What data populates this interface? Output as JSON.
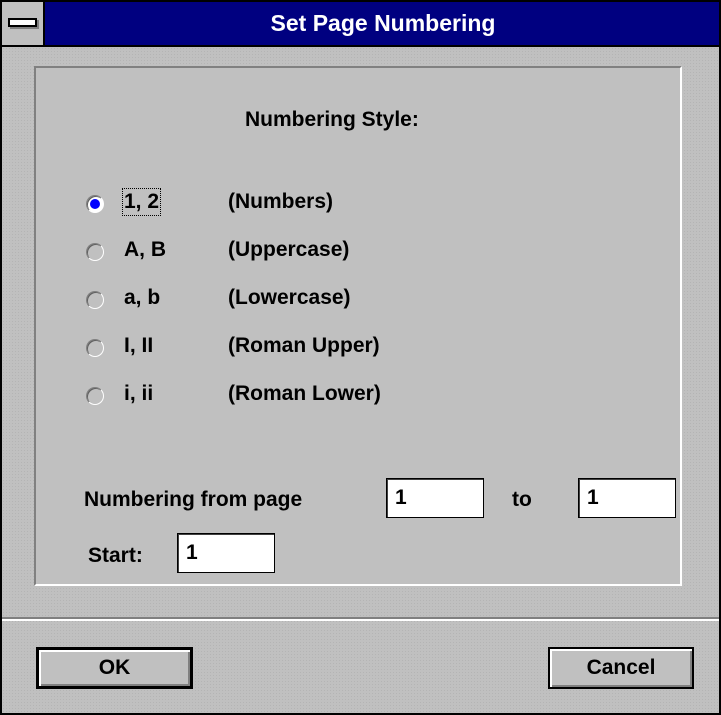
{
  "window": {
    "title": "Set Page Numbering"
  },
  "numbering_style": {
    "heading": "Numbering Style:",
    "options": [
      {
        "value": "1, 2",
        "description": "(Numbers)",
        "checked": true
      },
      {
        "value": "A, B",
        "description": "(Uppercase)",
        "checked": false
      },
      {
        "value": "a, b",
        "description": "(Lowercase)",
        "checked": false
      },
      {
        "value": "I, II",
        "description": "(Roman Upper)",
        "checked": false
      },
      {
        "value": "i, ii",
        "description": "(Roman Lower)",
        "checked": false
      }
    ]
  },
  "range": {
    "from_label": "Numbering from page",
    "from_value": "1",
    "to_label": "to",
    "to_value": "1",
    "start_label": "Start:",
    "start_value": "1"
  },
  "buttons": {
    "ok_label": "OK",
    "cancel_label": "Cancel"
  },
  "colors": {
    "titlebar": "#000080",
    "face": "#c0c0c0",
    "radio_selected": "#0000ff"
  }
}
